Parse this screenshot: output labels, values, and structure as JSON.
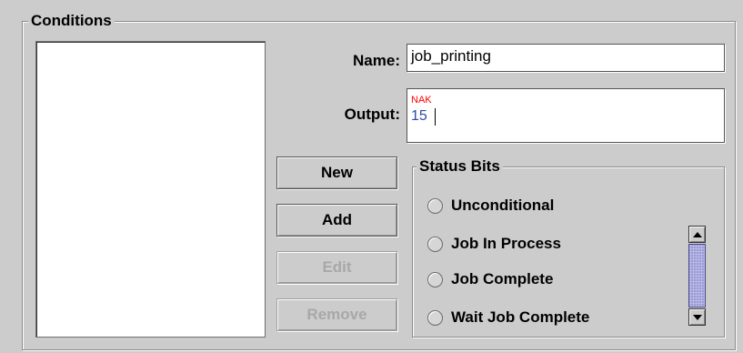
{
  "conditions": {
    "title": "Conditions",
    "name_label": "Name:",
    "name_value": "job_printing",
    "output_label": "Output:",
    "output_line1": "NAK",
    "output_line2": "15",
    "colors": {
      "nak": "#ff0000",
      "value": "#2b4ba8",
      "thumb": "#9c9cd6"
    }
  },
  "buttons": {
    "new": "New",
    "add": "Add",
    "edit": "Edit",
    "remove": "Remove"
  },
  "status_bits": {
    "title": "Status Bits",
    "options": [
      {
        "label": "Unconditional",
        "selected": false
      },
      {
        "label": "Job In Process",
        "selected": false
      },
      {
        "label": "Job Complete",
        "selected": false
      },
      {
        "label": "Wait Job Complete",
        "selected": false
      }
    ]
  }
}
